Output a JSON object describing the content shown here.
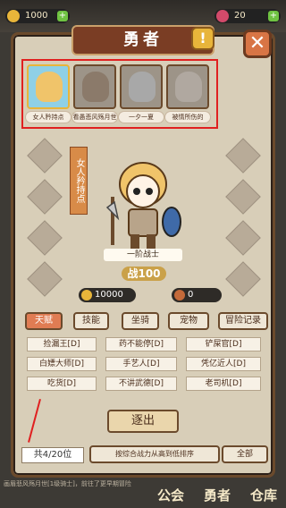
{
  "topbar": {
    "gold": "1000",
    "gems": "20",
    "gold_color": "#e8b53a",
    "gem_color": "#d24a6a"
  },
  "panel": {
    "title": "勇者",
    "help": "!",
    "close": "✕"
  },
  "hero_list": [
    {
      "name": "女人矜持点",
      "selected": true,
      "face_color": "#f0c46a"
    },
    {
      "name": "看愚悲风殇月世",
      "selected": false,
      "face_color": "#8b7a6a"
    },
    {
      "name": "一夕一夏",
      "selected": false,
      "face_color": "#a8a8a8"
    },
    {
      "name": "被情所伤的",
      "selected": false,
      "face_color": "#b0a8a0"
    }
  ],
  "hero": {
    "vertical_name": "女人矜持点",
    "rank": "一阶战士",
    "power_label": "战",
    "power": "100",
    "stat_gold": "10000",
    "stat_other": "0"
  },
  "tabs": [
    {
      "label": "天赋",
      "active": true
    },
    {
      "label": "技能",
      "active": false
    },
    {
      "label": "坐骑",
      "active": false
    },
    {
      "label": "宠物",
      "active": false
    },
    {
      "label": "冒险记录",
      "active": false
    }
  ],
  "skills": [
    "捡漏王[D]",
    "药不能停[D]",
    "铲屎官[D]",
    "白嫖大师[D]",
    "手艺人[D]",
    "凭亿近人[D]",
    "吃货[D]",
    "不讲武德[D]",
    "老司机[D]"
  ],
  "buttons": {
    "expel": "逐出",
    "sort": "按综合战力从高到低排序",
    "filter": "全部"
  },
  "count": "共4/20位",
  "ticker": "画眉悲风殇月世[1级骑士]，前往了更早期冒险",
  "nav": {
    "guild": "公会",
    "heroes": "勇者",
    "warehouse": "仓库"
  }
}
